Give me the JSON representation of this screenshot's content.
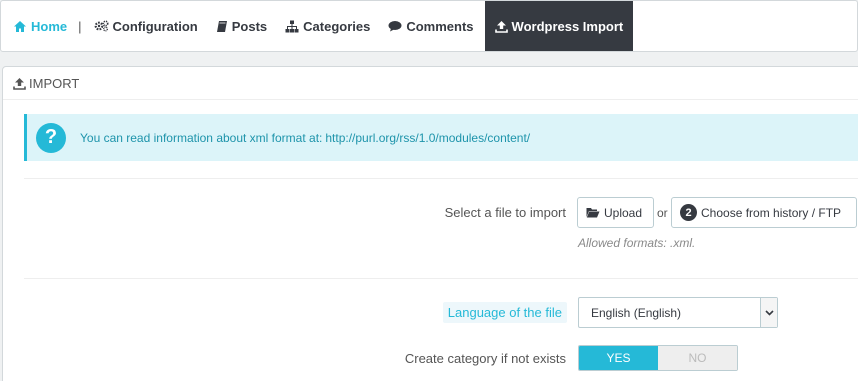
{
  "nav": {
    "home": "Home",
    "separator": "|",
    "configuration": "Configuration",
    "posts": "Posts",
    "categories": "Categories",
    "comments": "Comments",
    "wordpress_import": "Wordpress Import"
  },
  "panel": {
    "heading": "IMPORT"
  },
  "alert": {
    "text": "You can read information about xml format at:",
    "link": "http://purl.org/rss/1.0/modules/content/",
    "icon": "?"
  },
  "file": {
    "label": "Select a file to import",
    "upload_label": "Upload",
    "or": "or",
    "history_count": "2",
    "history_label": "Choose from history / FTP",
    "help": "Allowed formats: .xml."
  },
  "language": {
    "label": "Language of the file",
    "selected": "English (English)"
  },
  "create_category": {
    "label": "Create category if not exists",
    "yes": "YES",
    "no": "NO",
    "value": true
  },
  "colors": {
    "accent": "#25b9d7",
    "active_nav": "#363a41"
  }
}
